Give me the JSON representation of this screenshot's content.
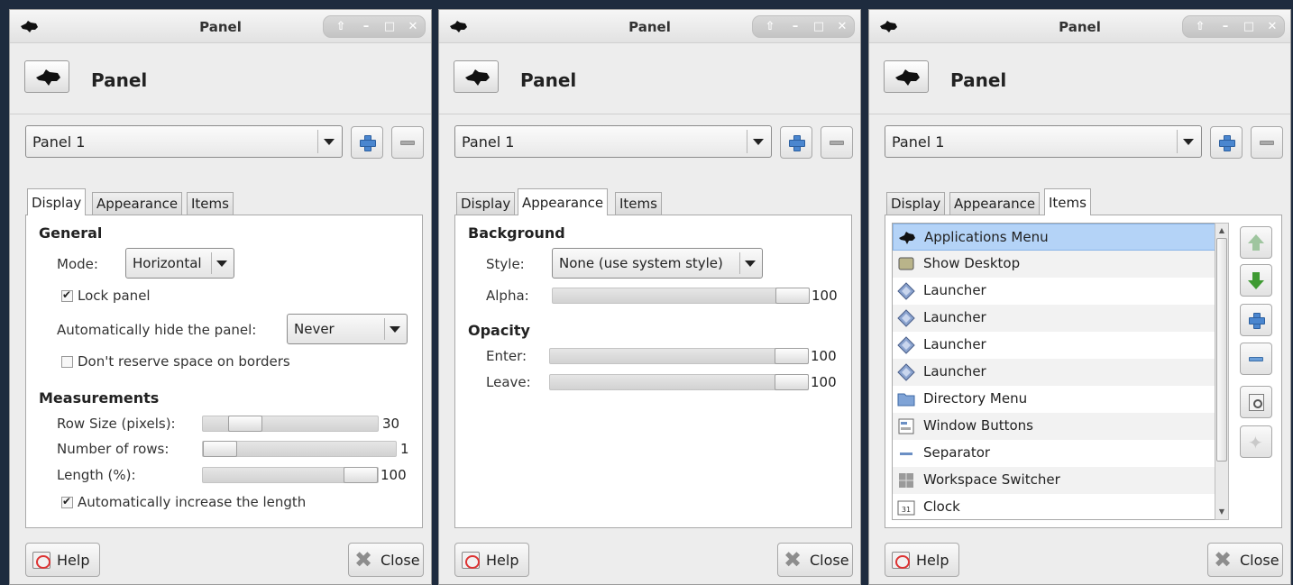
{
  "colors": {
    "desktop": "#1e2b3e",
    "selection": "#b4d3f7",
    "accent": "#4a86cf"
  },
  "windows": [
    {
      "title": "Panel",
      "header_title": "Panel",
      "panel_selector": {
        "value": "Panel 1"
      },
      "tabs": [
        "Display",
        "Appearance",
        "Items"
      ],
      "active_tab": "Display",
      "display": {
        "general_heading": "General",
        "mode_label": "Mode:",
        "mode_value": "Horizontal",
        "lock_panel_label": "Lock panel",
        "lock_panel_checked": true,
        "autohide_label": "Automatically hide the panel:",
        "autohide_value": "Never",
        "reserve_label": "Don't reserve space on borders",
        "reserve_checked": false,
        "measurements_heading": "Measurements",
        "row_size_label": "Row Size (pixels):",
        "row_size_value": "30",
        "row_size_fraction": 0.18,
        "rows_label": "Number of rows:",
        "rows_value": "1",
        "rows_fraction": 0.0,
        "length_label": "Length (%):",
        "length_value": "100",
        "length_fraction": 1.0,
        "auto_length_label": "Automatically increase the length",
        "auto_length_checked": true
      },
      "help_label": "Help",
      "close_label": "Close"
    },
    {
      "title": "Panel",
      "header_title": "Panel",
      "panel_selector": {
        "value": "Panel 1"
      },
      "tabs": [
        "Display",
        "Appearance",
        "Items"
      ],
      "active_tab": "Appearance",
      "appearance": {
        "background_heading": "Background",
        "style_label": "Style:",
        "style_value": "None (use system style)",
        "alpha_label": "Alpha:",
        "alpha_value": "100",
        "opacity_heading": "Opacity",
        "enter_label": "Enter:",
        "enter_value": "100",
        "leave_label": "Leave:",
        "leave_value": "100"
      },
      "help_label": "Help",
      "close_label": "Close"
    },
    {
      "title": "Panel",
      "header_title": "Panel",
      "panel_selector": {
        "value": "Panel 1"
      },
      "tabs": [
        "Display",
        "Appearance",
        "Items"
      ],
      "active_tab": "Items",
      "items": [
        {
          "label": "Applications Menu",
          "icon": "mouse-icon",
          "selected": true
        },
        {
          "label": "Show Desktop",
          "icon": "desktop-icon"
        },
        {
          "label": "Launcher",
          "icon": "launcher-icon"
        },
        {
          "label": "Launcher",
          "icon": "launcher-icon"
        },
        {
          "label": "Launcher",
          "icon": "launcher-icon"
        },
        {
          "label": "Launcher",
          "icon": "launcher-icon"
        },
        {
          "label": "Directory Menu",
          "icon": "folder-icon"
        },
        {
          "label": "Window Buttons",
          "icon": "window-buttons-icon"
        },
        {
          "label": "Separator",
          "icon": "separator-icon"
        },
        {
          "label": "Workspace Switcher",
          "icon": "workspace-icon"
        },
        {
          "label": "Clock",
          "icon": "clock-icon"
        }
      ],
      "help_label": "Help",
      "close_label": "Close"
    }
  ]
}
